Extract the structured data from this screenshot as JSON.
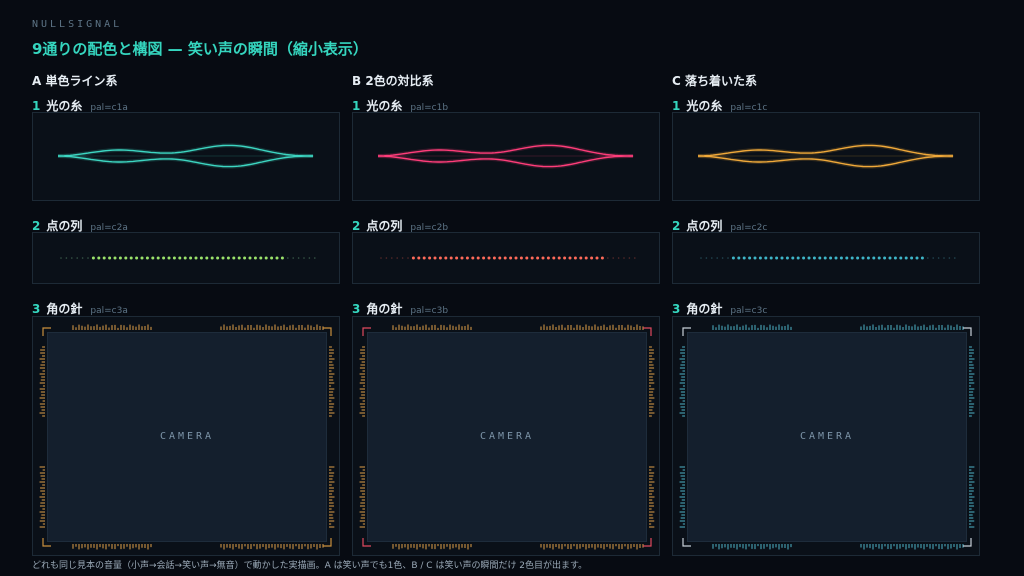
{
  "header": {
    "brand": "NULLSIGNAL",
    "title": "9通りの配色と構図 — 笑い声の瞬間（縮小表示）"
  },
  "columns": [
    {
      "heading": "A 単色ライン系",
      "rows": [
        {
          "num": "1",
          "name": "光の糸",
          "pal": "pal=c1a"
        },
        {
          "num": "2",
          "name": "点の列",
          "pal": "pal=c2a"
        },
        {
          "num": "3",
          "name": "角の針",
          "pal": "pal=c3a"
        }
      ],
      "camera_label": "CAMERA",
      "colors": {
        "line": "#3dd6c2",
        "line2": "#3dd6c2",
        "dots": "#9be36b",
        "dots_dim": "#3a5a4a",
        "ticks": "#e0a047",
        "ticks2": "#e0a047",
        "corner": "#c98f3d"
      }
    },
    {
      "heading": "B 2色の対比系",
      "rows": [
        {
          "num": "1",
          "name": "光の糸",
          "pal": "pal=c1b"
        },
        {
          "num": "2",
          "name": "点の列",
          "pal": "pal=c2b"
        },
        {
          "num": "3",
          "name": "角の針",
          "pal": "pal=c3b"
        }
      ],
      "camera_label": "CAMERA",
      "colors": {
        "line": "#ff3d7a",
        "line2": "#ff3d7a",
        "dots": "#ff6b5a",
        "dots_dim": "#5a2b2b",
        "ticks": "#e0a047",
        "ticks2": "#e0a047",
        "corner": "#e04a5f"
      }
    },
    {
      "heading": "C 落ち着いた系",
      "rows": [
        {
          "num": "1",
          "name": "光の糸",
          "pal": "pal=c1c"
        },
        {
          "num": "2",
          "name": "点の列",
          "pal": "pal=c2c"
        },
        {
          "num": "3",
          "name": "角の針",
          "pal": "pal=c3c"
        }
      ],
      "camera_label": "CAMERA",
      "colors": {
        "line": "#f0a93a",
        "line2": "#f0a93a",
        "dots": "#3fb6c8",
        "dots_dim": "#254a55",
        "ticks": "#4fb3c8",
        "ticks2": "#4fb3c8",
        "corner": "#c8d0d8"
      }
    }
  ],
  "footnote": "どれも同じ見本の音量（小声→会話→笑い声→無音）で動かした実描画。A は笑い声でも1色、B / C は笑い声の瞬間だけ 2色目が出ます。"
}
